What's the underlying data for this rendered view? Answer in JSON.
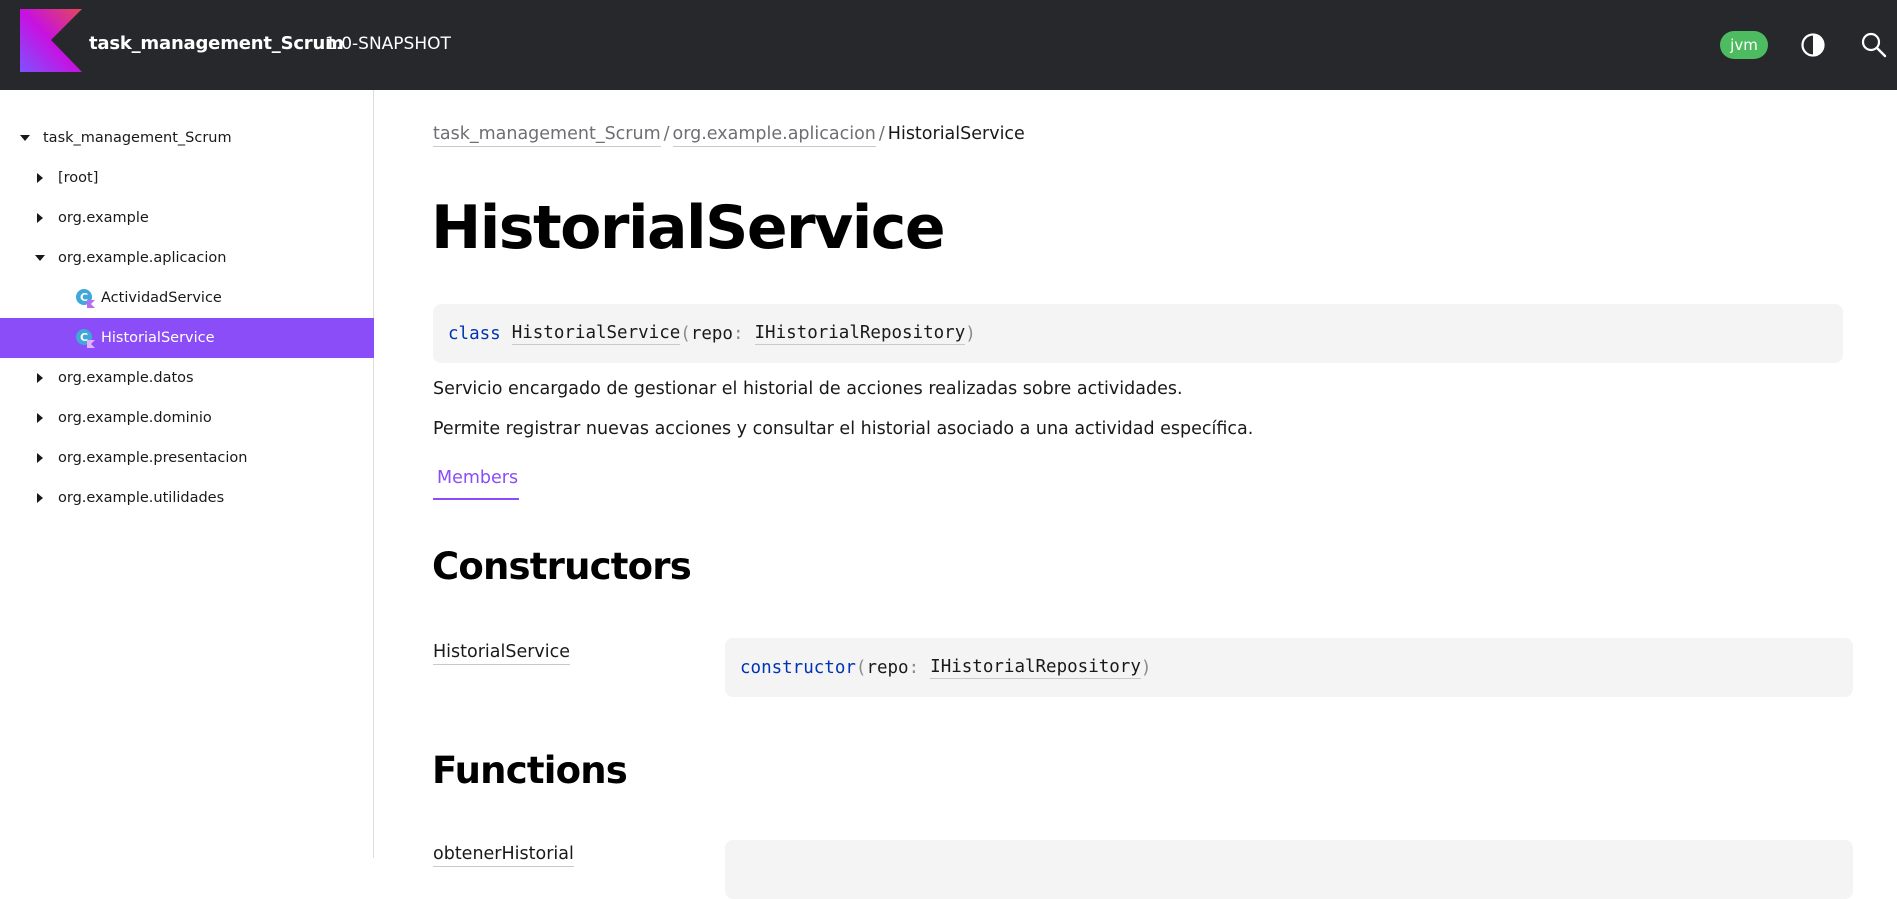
{
  "header": {
    "project_name": "task_management_Scrum",
    "version": "1.0-SNAPSHOT",
    "platform_badge": "jvm",
    "logo_icon": "kotlin-logo",
    "theme_icon": "contrast-icon",
    "search_icon": "search-icon"
  },
  "sidebar": {
    "items": [
      {
        "label": "task_management_Scrum",
        "expanded": true
      },
      {
        "label": "[root]",
        "expanded": false
      },
      {
        "label": "org.example",
        "expanded": false
      },
      {
        "label": "org.example.aplicacion",
        "expanded": true
      },
      {
        "label": "ActividadService",
        "icon": "class-icon"
      },
      {
        "label": "HistorialService",
        "icon": "class-icon",
        "selected": true
      },
      {
        "label": "org.example.datos",
        "expanded": false
      },
      {
        "label": "org.example.dominio",
        "expanded": false
      },
      {
        "label": "org.example.presentacion",
        "expanded": false
      },
      {
        "label": "org.example.utilidades",
        "expanded": false
      }
    ]
  },
  "breadcrumb": {
    "items": [
      "task_management_Scrum",
      "org.example.aplicacion"
    ],
    "current": "HistorialService",
    "separator": "/"
  },
  "main": {
    "title": "HistorialService",
    "signature": {
      "keyword": "class",
      "name": "HistorialService",
      "open_paren": "(",
      "param_name": "repo",
      "colon": ":",
      "param_type": "IHistorialRepository",
      "close_paren": ")"
    },
    "description": [
      "Servicio encargado de gestionar el historial de acciones realizadas sobre actividades.",
      "Permite registrar nuevas acciones y consultar el historial asociado a una actividad específica."
    ],
    "tabs": [
      {
        "label": "Members",
        "active": true
      }
    ],
    "constructors": {
      "title": "Constructors",
      "items": [
        {
          "name": "HistorialService",
          "keyword": "constructor",
          "open_paren": "(",
          "param_name": "repo",
          "colon": ":",
          "param_type": "IHistorialRepository",
          "close_paren": ")"
        }
      ]
    },
    "functions": {
      "title": "Functions",
      "items": [
        {
          "name": "obtenerHistorial"
        }
      ]
    }
  },
  "colors": {
    "header_bg": "#27282c",
    "accent": "#8b4df7",
    "badge_green": "#4dbb5f",
    "keyword_blue": "#0033b3",
    "code_bg": "#f4f4f4"
  }
}
